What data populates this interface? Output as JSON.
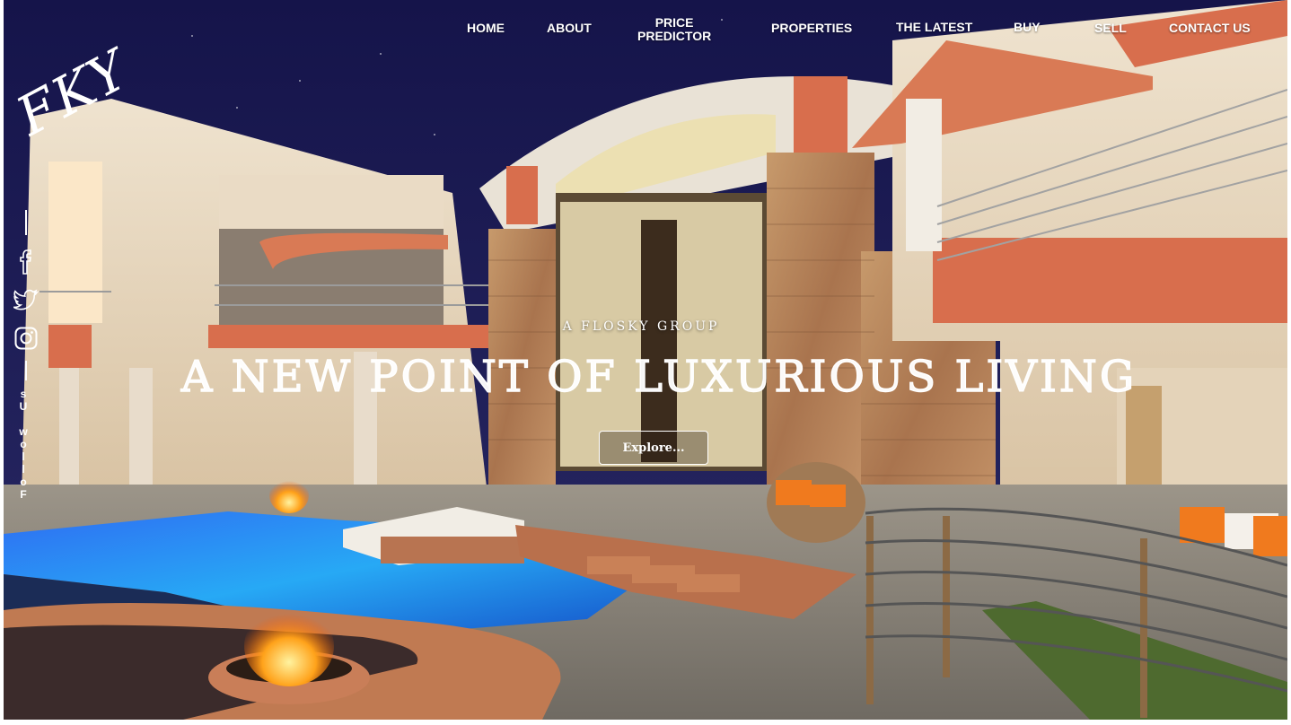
{
  "brand": {
    "logo_text": "FKY"
  },
  "nav": {
    "items": [
      {
        "label": "HOME"
      },
      {
        "label": "ABOUT"
      },
      {
        "label": "PRICE\nPREDICTOR"
      },
      {
        "label": "PROPERTIES"
      },
      {
        "label": "THE LATEST"
      },
      {
        "label": "BUY"
      },
      {
        "label": "SELL"
      },
      {
        "label": "CONTACT US"
      }
    ]
  },
  "social": {
    "icons": [
      "facebook-icon",
      "twitter-icon",
      "instagram-icon"
    ],
    "follow_text": "Follow Us"
  },
  "hero": {
    "kicker": "A FLOSKY GROUP",
    "headline": "A NEW POINT OF LUXURIOUS LIVING",
    "cta_label": "Explore..."
  },
  "colors": {
    "night_sky": "#1b1a45",
    "terracotta": "#d2704f",
    "pool_blue": "#1f8fe0",
    "stone": "#b98a63",
    "text": "#ffffff"
  }
}
